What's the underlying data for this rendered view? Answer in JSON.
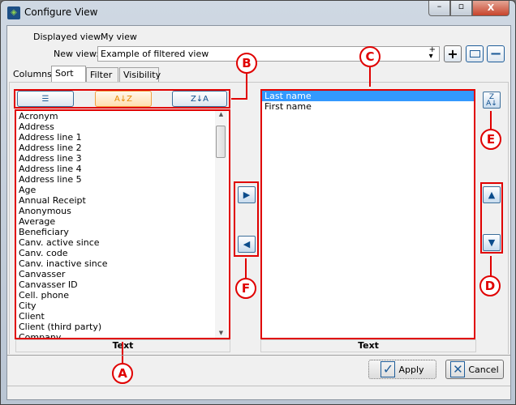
{
  "window": {
    "title": "Configure View",
    "minimize": "–",
    "maximize": "▫",
    "close": "X"
  },
  "header": {
    "displayed_label": "Displayed view:",
    "displayed_value": "My view",
    "new_label": "New view:",
    "new_value": "Example of filtered view"
  },
  "tabs": [
    "Columns",
    "Sort",
    "Filter",
    "Visibility"
  ],
  "left_list": {
    "items": [
      "Acronym",
      "Address",
      "Address line 1",
      "Address line 2",
      "Address line 3",
      "Address line 4",
      "Address line 5",
      "Age",
      "Annual Receipt",
      "Anonymous",
      "Average",
      "Beneficiary",
      "Canv. active since",
      "Canv. code",
      "Canv. inactive since",
      "Canvasser",
      "Canvasser ID",
      "Cell. phone",
      "City",
      "Client",
      "Client (third party)",
      "Company"
    ],
    "header": "Text"
  },
  "right_list": {
    "items": [
      "Last name",
      "First name"
    ],
    "selected": "Last name",
    "header": "Text"
  },
  "callouts": {
    "a": "A",
    "b": "B",
    "c": "C",
    "d": "D",
    "e": "E",
    "f": "F"
  },
  "buttons": {
    "apply": "Apply",
    "cancel": "Cancel",
    "sort_az": "A↓Z",
    "sort_za": "Z↓A"
  },
  "colors": {
    "callout": "#e00000",
    "selection": "#3399ff"
  }
}
